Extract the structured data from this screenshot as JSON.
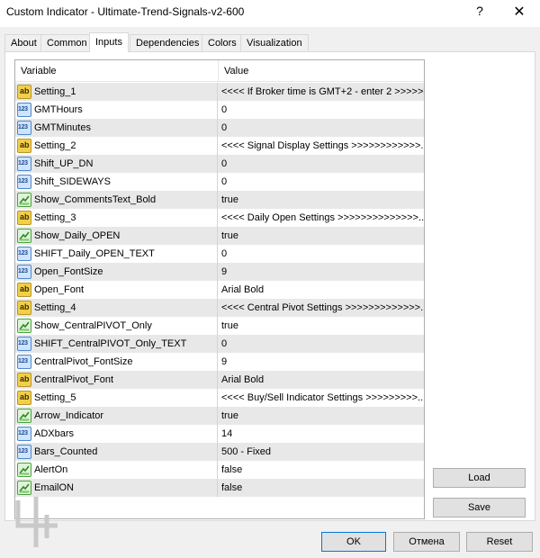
{
  "window": {
    "title": "Custom Indicator - Ultimate-Trend-Signals-v2-600",
    "help_glyph": "?",
    "close_glyph": "✕"
  },
  "tabs": [
    {
      "label": "About",
      "active": false
    },
    {
      "label": "Common",
      "active": false
    },
    {
      "label": "Inputs",
      "active": true
    },
    {
      "label": "Dependencies",
      "active": false
    },
    {
      "label": "Colors",
      "active": false
    },
    {
      "label": "Visualization",
      "active": false
    }
  ],
  "grid": {
    "headers": {
      "variable": "Variable",
      "value": "Value"
    },
    "rows": [
      {
        "type": "ab",
        "variable": "Setting_1",
        "value": "<<<< If Broker time is GMT+2 - enter 2 >>>>>>"
      },
      {
        "type": "123",
        "variable": "GMTHours",
        "value": "0"
      },
      {
        "type": "123",
        "variable": "GMTMinutes",
        "value": "0"
      },
      {
        "type": "ab",
        "variable": "Setting_2",
        "value": "<<<< Signal Display Settings >>>>>>>>>>>>..."
      },
      {
        "type": "123",
        "variable": "Shift_UP_DN",
        "value": "0"
      },
      {
        "type": "123",
        "variable": "Shift_SIDEWAYS",
        "value": "0"
      },
      {
        "type": "bool",
        "variable": "Show_CommentsText_Bold",
        "value": "true"
      },
      {
        "type": "ab",
        "variable": "Setting_3",
        "value": "<<<< Daily Open Settings >>>>>>>>>>>>>>..."
      },
      {
        "type": "bool",
        "variable": "Show_Daily_OPEN",
        "value": "true"
      },
      {
        "type": "123",
        "variable": "SHIFT_Daily_OPEN_TEXT",
        "value": "0"
      },
      {
        "type": "123",
        "variable": "Open_FontSize",
        "value": "9"
      },
      {
        "type": "ab",
        "variable": "Open_Font",
        "value": "Arial Bold"
      },
      {
        "type": "ab",
        "variable": "Setting_4",
        "value": "<<<< Central Pivot Settings >>>>>>>>>>>>>..."
      },
      {
        "type": "bool",
        "variable": "Show_CentralPIVOT_Only",
        "value": "true"
      },
      {
        "type": "123",
        "variable": "SHIFT_CentralPIVOT_Only_TEXT",
        "value": "0"
      },
      {
        "type": "123",
        "variable": "CentralPivot_FontSize",
        "value": "9"
      },
      {
        "type": "ab",
        "variable": "CentralPivot_Font",
        "value": "Arial Bold"
      },
      {
        "type": "ab",
        "variable": "Setting_5",
        "value": "<<<< Buy/Sell Indicator Settings >>>>>>>>>..."
      },
      {
        "type": "bool",
        "variable": "Arrow_Indicator",
        "value": "true"
      },
      {
        "type": "123",
        "variable": "ADXbars",
        "value": "14"
      },
      {
        "type": "123",
        "variable": "Bars_Counted",
        "value": "500 - Fixed"
      },
      {
        "type": "bool",
        "variable": "AlertOn",
        "value": "false"
      },
      {
        "type": "bool",
        "variable": "EmailON",
        "value": "false"
      }
    ]
  },
  "side_buttons": {
    "load": "Load",
    "save": "Save"
  },
  "footer_buttons": {
    "ok": "OK",
    "cancel": "Отмена",
    "reset": "Reset"
  },
  "icons": {
    "string": "ab",
    "integer": "123",
    "boolean": "bool-icon"
  }
}
